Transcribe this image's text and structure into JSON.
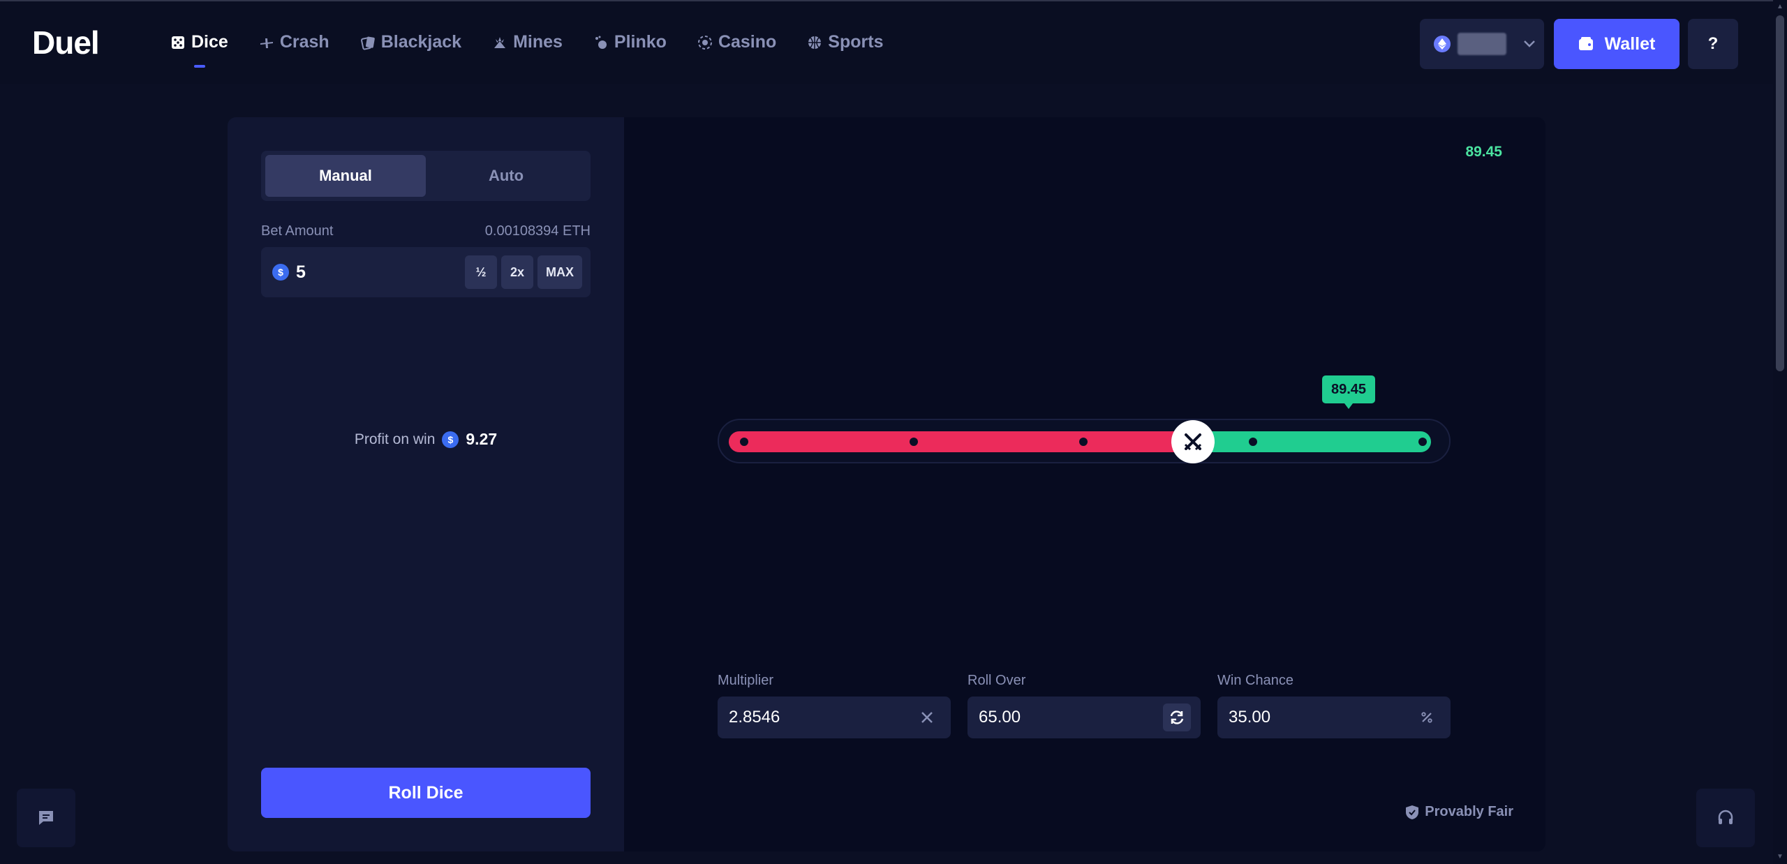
{
  "brand": {
    "name": "Duel"
  },
  "nav": {
    "items": [
      {
        "label": "Dice",
        "active": true
      },
      {
        "label": "Crash",
        "active": false
      },
      {
        "label": "Blackjack",
        "active": false
      },
      {
        "label": "Mines",
        "active": false
      },
      {
        "label": "Plinko",
        "active": false
      },
      {
        "label": "Casino",
        "active": false
      },
      {
        "label": "Sports",
        "active": false
      }
    ]
  },
  "header": {
    "wallet_label": "Wallet",
    "help_label": "?"
  },
  "side": {
    "mode_manual": "Manual",
    "mode_auto": "Auto",
    "bet_label": "Bet Amount",
    "bet_eth": "0.00108394 ETH",
    "bet_value": "5",
    "half_label": "½",
    "double_label": "2x",
    "max_label": "MAX",
    "profit_label": "Profit on win",
    "profit_value": "9.27",
    "roll_label": "Roll Dice"
  },
  "game": {
    "last_roll": "89.45",
    "result_tag": "89.45",
    "roll_over_fraction": 0.65,
    "multiplier_label": "Multiplier",
    "multiplier_value": "2.8546",
    "roll_over_label": "Roll Over",
    "roll_over_value": "65.00",
    "win_chance_label": "Win Chance",
    "win_chance_value": "35.00",
    "provably_fair": "Provably Fair"
  },
  "colors": {
    "accent": "#4a56ff",
    "lose": "#ec2b5b",
    "win": "#20cd90"
  }
}
